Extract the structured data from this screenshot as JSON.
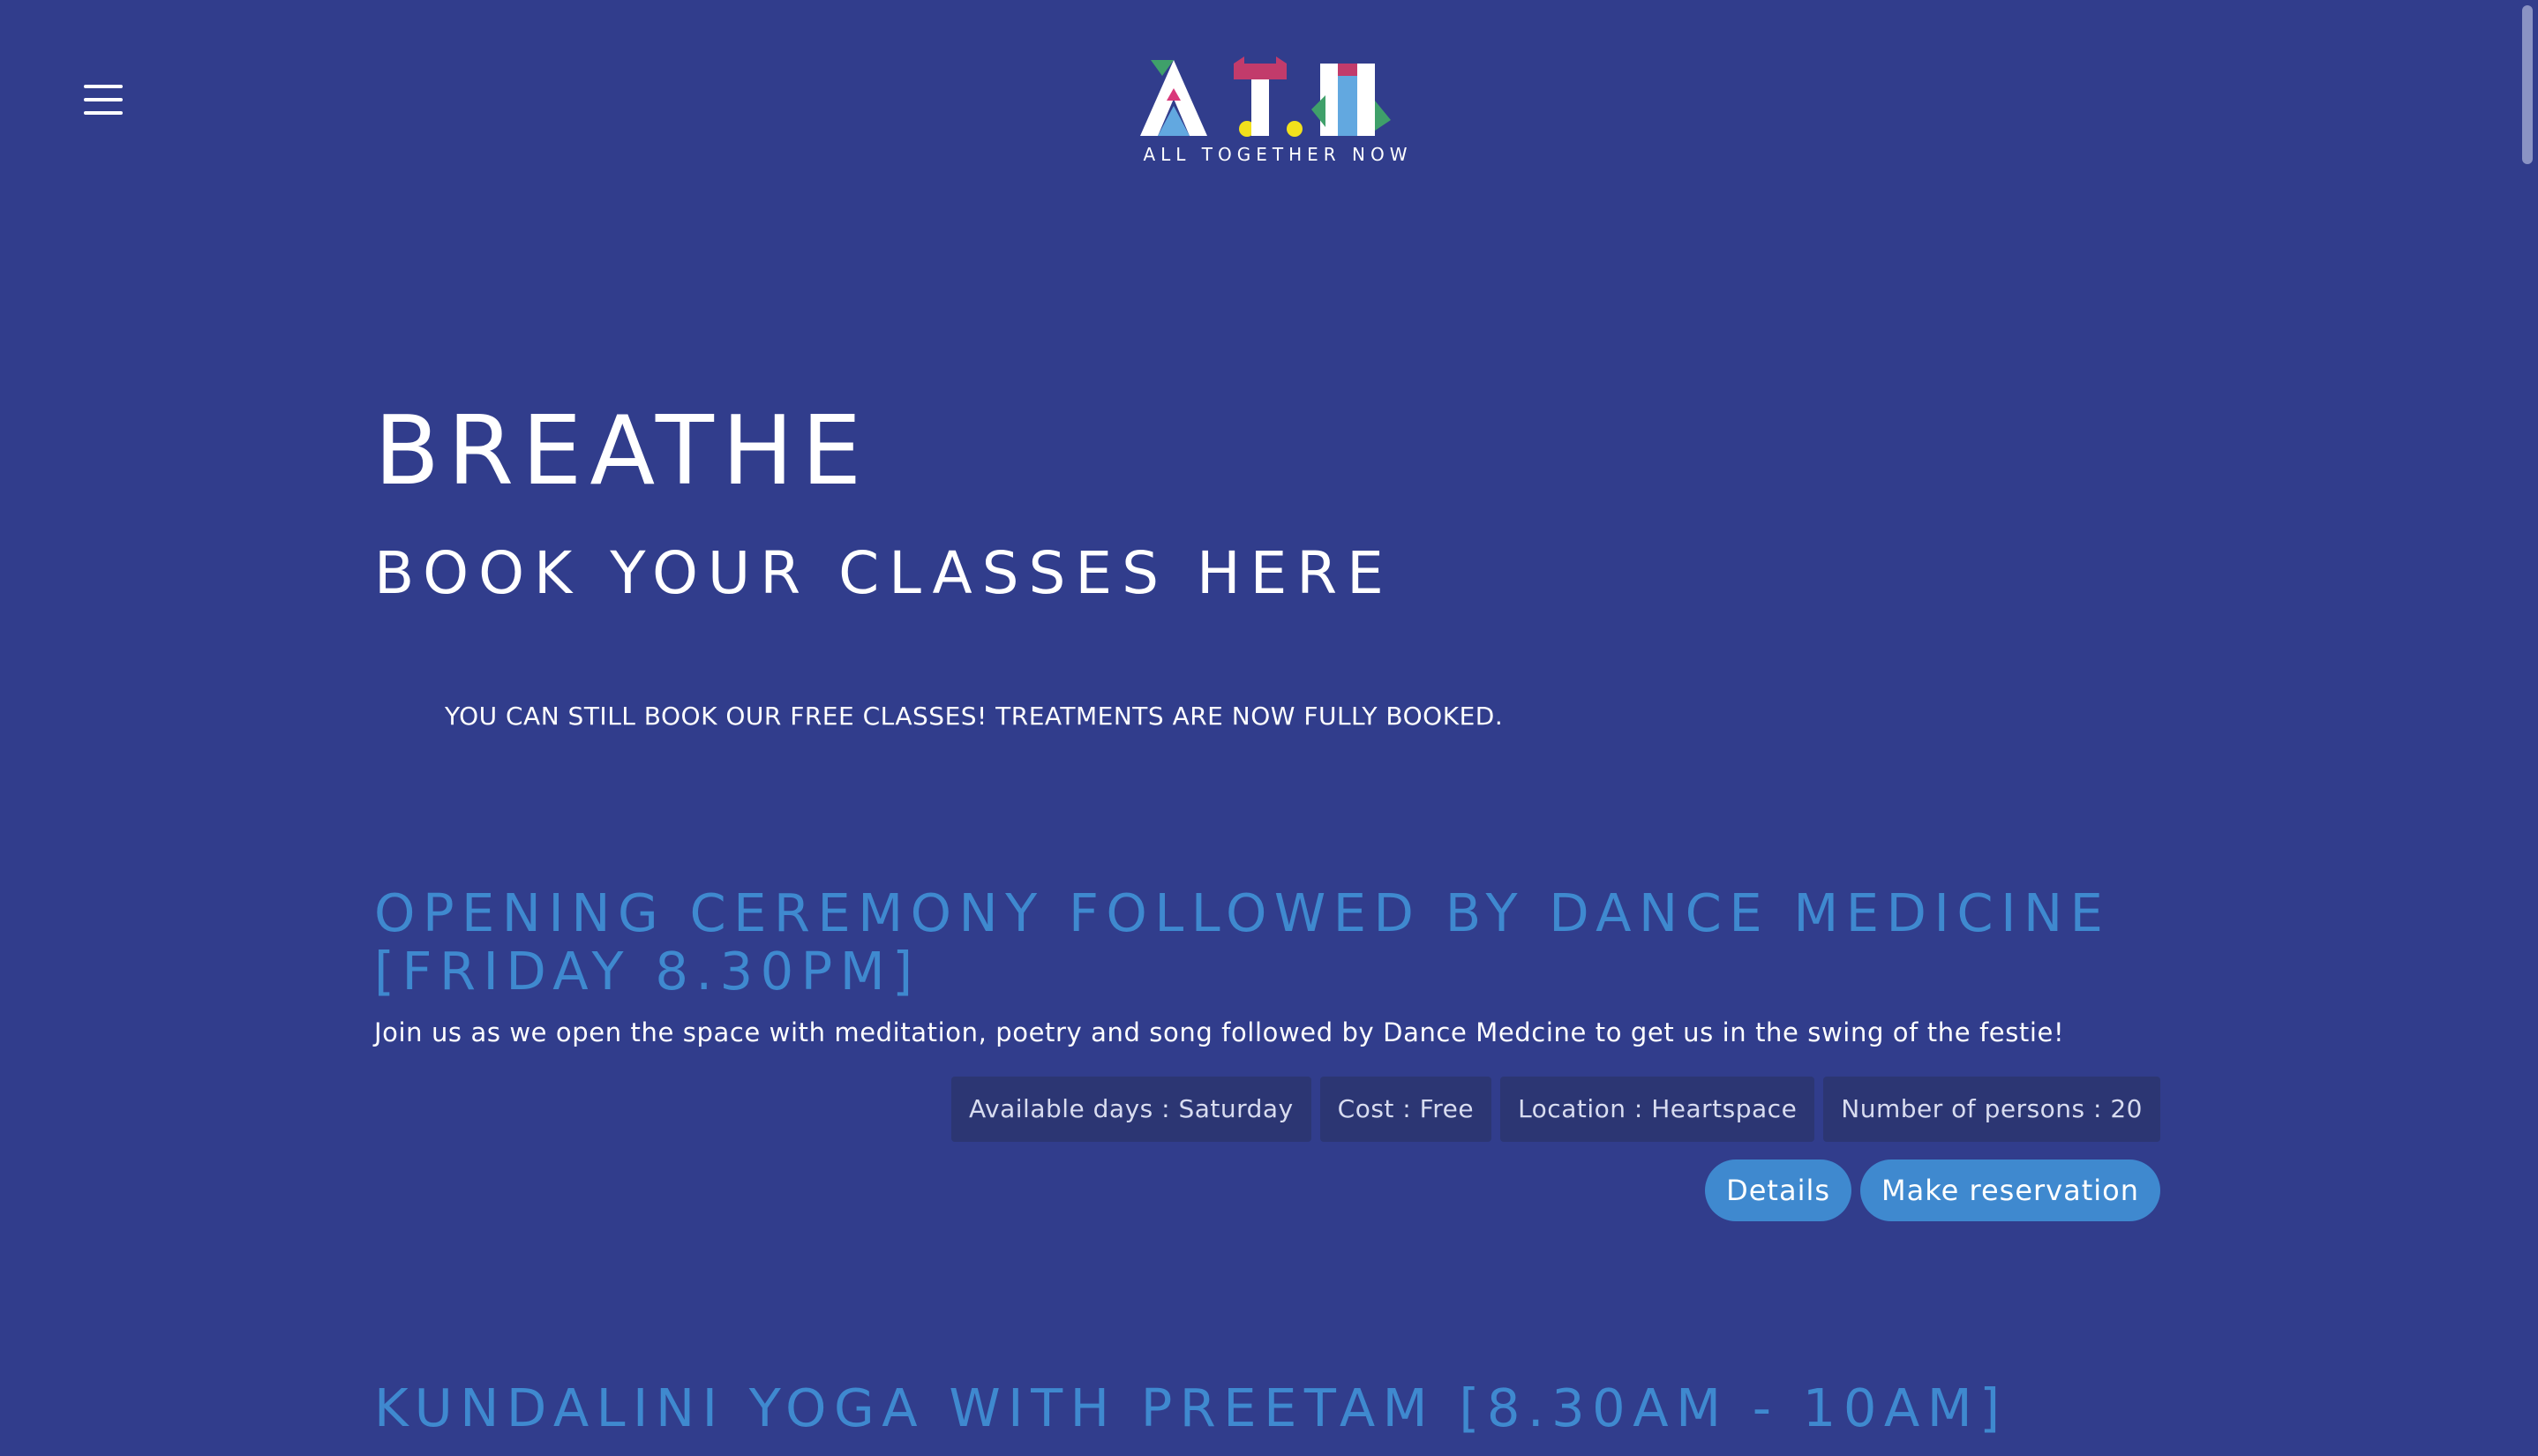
{
  "header": {
    "menu_icon": "hamburger-menu-icon",
    "logo_text": "A.T.N",
    "logo_caption": "ALL TOGETHER NOW"
  },
  "main": {
    "title": "BREATHE",
    "subtitle": "BOOK YOUR CLASSES HERE",
    "notice": "YOU CAN STILL BOOK OUR FREE CLASSES! TREATMENTS ARE NOW FULLY BOOKED."
  },
  "events": [
    {
      "title": "OPENING CEREMONY FOLLOWED BY DANCE MEDICINE [FRIDAY 8.30PM]",
      "description": "Join us as we open the space with meditation, poetry and song followed by Dance Medcine to get us in the swing of the festie!",
      "tags": {
        "available_days": "Available days : Saturday",
        "cost": "Cost : Free",
        "location": "Location : Heartspace",
        "persons": "Number of persons : 20"
      },
      "details_label": "Details",
      "reserve_label": "Make reservation"
    },
    {
      "title": "KUNDALINI YOGA WITH PREETAM [8.30AM - 10AM]"
    }
  ],
  "colors": {
    "background": "#313d8c",
    "accent": "#3f89cf",
    "tag_bg": "#2c3673"
  }
}
